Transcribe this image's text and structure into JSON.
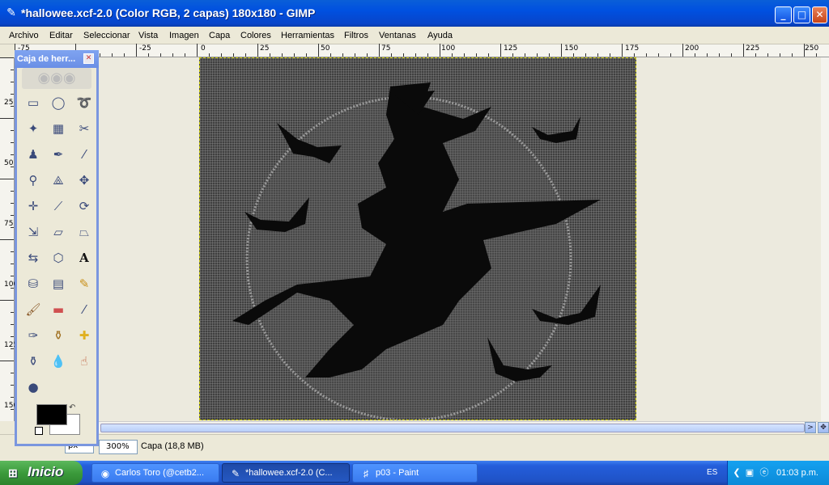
{
  "window": {
    "title": "*hallowee.xcf-2.0 (Color RGB, 2 capas) 180x180 - GIMP",
    "minimize": "_",
    "maximize": "□",
    "close": "✕"
  },
  "menu": [
    "Archivo",
    "Editar",
    "Seleccionar",
    "Vista",
    "Imagen",
    "Capa",
    "Colores",
    "Herramientas",
    "Filtros",
    "Ventanas",
    "Ayuda"
  ],
  "ruler": {
    "top": [
      "-75",
      "-25",
      "0",
      "25",
      "50",
      "75",
      "100",
      "125",
      "150",
      "175",
      "200",
      "225",
      "250"
    ],
    "left": [
      "25",
      "50",
      "75",
      "100",
      "125",
      "150"
    ]
  },
  "toolbox": {
    "title": "Caja de herr...",
    "close": "✕",
    "tools": [
      "rect-select-icon",
      "ellipse-select-icon",
      "lasso-icon",
      "fuzzy-select-icon",
      "color-select-icon",
      "scissors-icon",
      "foreground-select-icon",
      "paths-icon",
      "color-picker-icon",
      "zoom-icon",
      "measure-icon",
      "move-icon",
      "align-icon",
      "crop-icon",
      "rotate-icon",
      "scale-icon",
      "shear-icon",
      "perspective-icon",
      "flip-icon",
      "cage-icon",
      "text-icon",
      "bucket-fill-icon",
      "gradient-icon",
      "pencil-icon",
      "paintbrush-icon",
      "eraser-icon",
      "airbrush-icon",
      "ink-icon",
      "clone-icon",
      "heal-icon",
      "perspective-clone-icon",
      "blur-icon",
      "smudge-icon",
      "dodge-burn-icon"
    ],
    "fg_color": "#000000",
    "bg_color": "#ffffff"
  },
  "status": {
    "unit": "px",
    "zoom": "300%",
    "layer": "Capa (18,8 MB)"
  },
  "taskbar": {
    "start": "Inicio",
    "tasks": [
      "Carlos Toro (@cetb2...",
      "*hallowee.xcf-2.0 (C...",
      "p03 - Paint"
    ],
    "lang": "ES",
    "clock": "01:03 p.m."
  }
}
